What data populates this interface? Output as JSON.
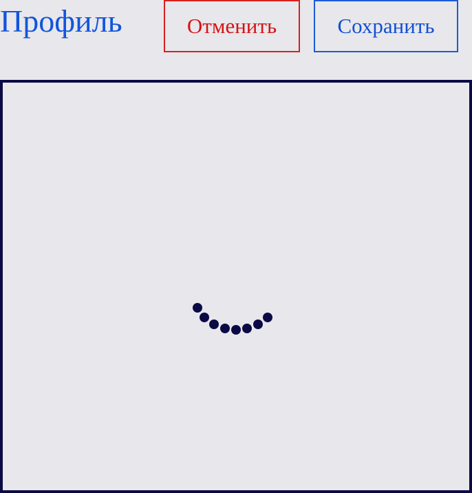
{
  "header": {
    "title": "Профиль",
    "cancel_label": "Отменить",
    "save_label": "Сохранить"
  },
  "main": {
    "spinner_icon": "loading-spinner-icon"
  },
  "colors": {
    "background": "#e8e7eb",
    "title": "#1155dd",
    "cancel": "#d41515",
    "save": "#1150d4",
    "frame": "#0b0a45",
    "spinner": "#0b0a45"
  }
}
